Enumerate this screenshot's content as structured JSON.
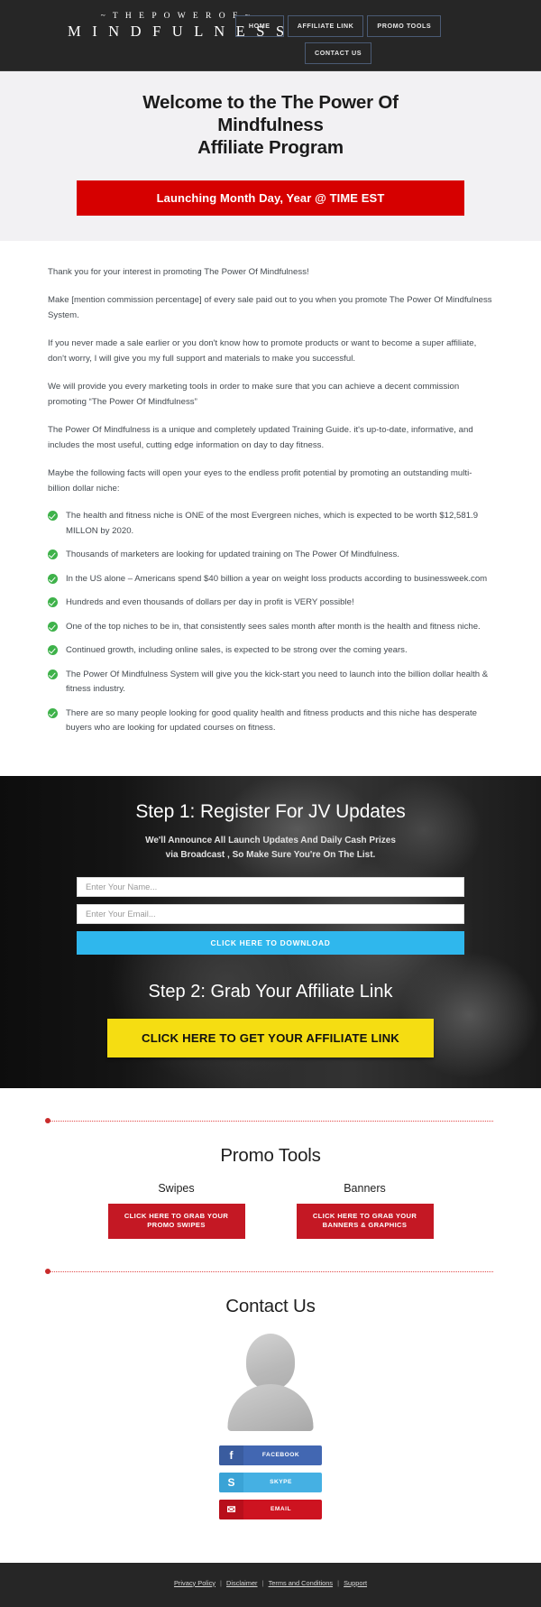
{
  "header": {
    "brand_top": "~ T H E   P O W E R   O F ~",
    "brand_main": "M I N D F U L N E S S",
    "nav": [
      {
        "label": "HOME"
      },
      {
        "label": "AFFILIATE LINK"
      },
      {
        "label": "PROMO TOOLS"
      },
      {
        "label": "CONTACT US"
      }
    ]
  },
  "hero": {
    "title_line1": "Welcome to the The Power Of",
    "title_line2": "Mindfulness",
    "title_line3": "Affiliate Program",
    "banner": "Launching Month Day, Year @ TIME EST",
    "banner_color": "#d60000"
  },
  "content": {
    "paragraphs": [
      "Thank you for your interest in promoting The Power Of Mindfulness!",
      "Make [mention commission percentage] of every sale paid out to you when you promote The Power Of Mindfulness System.",
      "If you never made a sale earlier or you don't know how to promote products or want to become a super affiliate, don't worry, I will give you my full support and materials to make you successful.",
      "We will provide you every marketing tools in order to make sure that you can achieve a decent commission promoting “The Power Of Mindfulness”",
      "The Power Of Mindfulness is a unique and completely updated Training Guide. it's up-to-date, informative, and includes the most useful, cutting edge information on day to day fitness.",
      "Maybe the following facts will open your eyes to the endless profit potential by promoting an outstanding multi-billion dollar niche:"
    ],
    "facts": [
      "The health and fitness niche is ONE of the most Evergreen niches, which is expected to be worth $12,581.9 MILLON by 2020.",
      "Thousands of marketers are looking for updated training on The Power Of Mindfulness.",
      "In the US alone – Americans spend $40 billion a year on weight loss products according to businessweek.com",
      "Hundreds and even thousands of dollars per day in profit is VERY possible!",
      "One of the top niches to be in, that consistently sees sales month after month is the health and fitness niche.",
      "Continued growth, including online sales, is expected to be strong over the coming years.",
      "The Power Of Mindfulness System will give you the kick-start you need to launch into the billion dollar health & fitness industry.",
      "There are so many people looking for good quality health and fitness products and this niche has desperate buyers who are looking for updated courses on fitness."
    ],
    "check_icon": "check-circle-icon",
    "check_color": "#3eb24a"
  },
  "steps": {
    "step1_title": "Step 1: Register For JV Updates",
    "step1_sub_line1": "We'll Announce All Launch Updates And Daily Cash Prizes",
    "step1_sub_line2": "via Broadcast , So Make Sure You're On The List.",
    "name_placeholder": "Enter Your Name...",
    "name_value": "",
    "email_placeholder": "Enter Your Email...",
    "email_value": "",
    "download_button": "CLICK HERE TO DOWNLOAD",
    "download_button_color": "#2fb7ed",
    "step2_title": "Step 2: Grab Your Affiliate Link",
    "affiliate_button": "CLICK HERE TO GET YOUR AFFILIATE LINK",
    "affiliate_button_color": "#f5dd12"
  },
  "promo": {
    "title": "Promo Tools",
    "columns": [
      {
        "heading": "Swipes",
        "button_line1": "CLICK HERE TO GRAB YOUR",
        "button_line2": "PROMO SWIPES"
      },
      {
        "heading": "Banners",
        "button_line1": "CLICK HERE TO GRAB YOUR",
        "button_line2": "BANNERS & GRAPHICS"
      }
    ],
    "button_color": "#c41824"
  },
  "contact": {
    "title": "Contact Us",
    "avatar": "user-avatar-placeholder",
    "socials": [
      {
        "icon": "facebook-icon",
        "glyph": "f",
        "label": "FACEBOOK",
        "color": "#4267b2"
      },
      {
        "icon": "skype-icon",
        "glyph": "S",
        "label": "SKYPE",
        "color": "#45b0e3"
      },
      {
        "icon": "email-icon",
        "glyph": "✉",
        "label": "EMAIL",
        "color": "#cd1320"
      }
    ]
  },
  "footer": {
    "links": [
      {
        "label": "Privacy Policy"
      },
      {
        "label": "Disclaimer"
      },
      {
        "label": "Terms and Conditions"
      },
      {
        "label": "Support"
      }
    ],
    "separator": "|"
  }
}
